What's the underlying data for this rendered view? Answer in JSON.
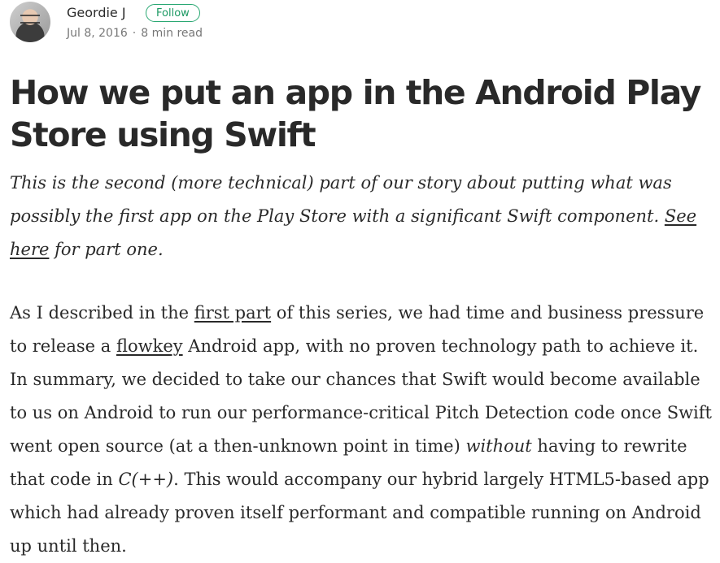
{
  "author": {
    "name": "Geordie J",
    "follow_label": "Follow",
    "date": "Jul 8, 2016",
    "separator": "·",
    "read_time": "8 min read"
  },
  "article": {
    "title": "How we put an app in the Android Play Store using Swift",
    "subtitle": {
      "text_before": "This is the second (more technical) part of our story about putting what was possibly the first app on the Play Store with a significant Swift component. ",
      "link": "See here",
      "text_after": " for part one."
    },
    "paragraph1": {
      "t1": "As I described in the ",
      "link1": "first part",
      "t2": " of this series, we had time and business pressure to release a ",
      "link2": "flowkey",
      "t3": " Android app, with no proven technology path to achieve it. In summary, we decided to take our chances that Swift would become available to us on Android to run our performance-critical Pitch Detection code once Swift went open source (at a then-unknown point in time) ",
      "em1": "without",
      "t4": " having to rewrite that code in ",
      "em2": "C(++)",
      "t5": ". This would accompany our hybrid largely HTML5-based app which had already proven itself performant and compatible running on Android up until then."
    }
  },
  "colors": {
    "text": "#1f1f1f",
    "meta": "#757575",
    "follow_accent": "#1c9963"
  }
}
